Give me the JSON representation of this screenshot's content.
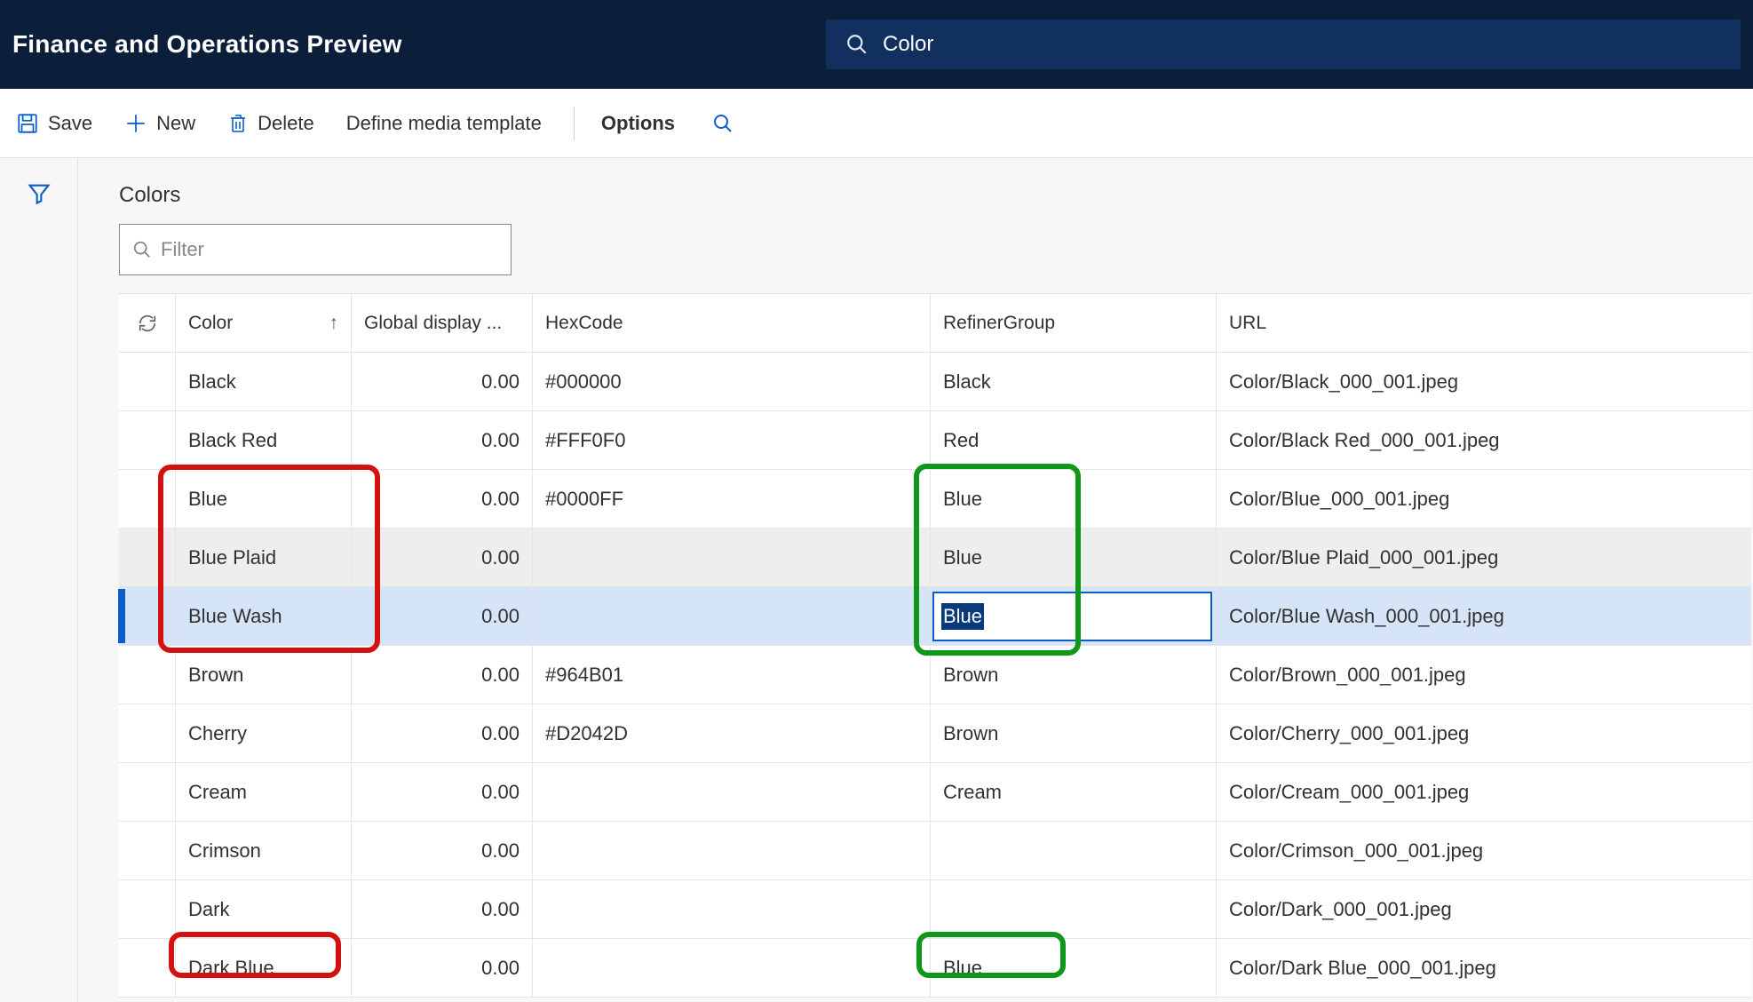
{
  "header": {
    "title": "Finance and Operations Preview",
    "search_value": "Color"
  },
  "actionbar": {
    "save": "Save",
    "new": "New",
    "delete": "Delete",
    "define_media_template": "Define media template",
    "options": "Options"
  },
  "page": {
    "title": "Colors",
    "filter_placeholder": "Filter"
  },
  "grid": {
    "columns": {
      "color": "Color",
      "global_display": "Global display ...",
      "hexcode": "HexCode",
      "refiner_group": "RefinerGroup",
      "url": "URL"
    },
    "rows": [
      {
        "color": "Black",
        "gdo": "0.00",
        "hex": "#000000",
        "ref": "Black",
        "url": "Color/Black_000_001.jpeg"
      },
      {
        "color": "Black Red",
        "gdo": "0.00",
        "hex": "#FFF0F0",
        "ref": "Red",
        "url": "Color/Black Red_000_001.jpeg"
      },
      {
        "color": "Blue",
        "gdo": "0.00",
        "hex": "#0000FF",
        "ref": "Blue",
        "url": "Color/Blue_000_001.jpeg"
      },
      {
        "color": "Blue Plaid",
        "gdo": "0.00",
        "hex": "",
        "ref": "Blue",
        "url": "Color/Blue Plaid_000_001.jpeg"
      },
      {
        "color": "Blue Wash",
        "gdo": "0.00",
        "hex": "",
        "ref": "Blue",
        "url": "Color/Blue Wash_000_001.jpeg"
      },
      {
        "color": "Brown",
        "gdo": "0.00",
        "hex": "#964B01",
        "ref": "Brown",
        "url": "Color/Brown_000_001.jpeg"
      },
      {
        "color": "Cherry",
        "gdo": "0.00",
        "hex": "#D2042D",
        "ref": "Brown",
        "url": "Color/Cherry_000_001.jpeg"
      },
      {
        "color": "Cream",
        "gdo": "0.00",
        "hex": "",
        "ref": "Cream",
        "url": "Color/Cream_000_001.jpeg"
      },
      {
        "color": "Crimson",
        "gdo": "0.00",
        "hex": "",
        "ref": "",
        "url": "Color/Crimson_000_001.jpeg"
      },
      {
        "color": "Dark",
        "gdo": "0.00",
        "hex": "",
        "ref": "",
        "url": "Color/Dark_000_001.jpeg"
      },
      {
        "color": "Dark Blue",
        "gdo": "0.00",
        "hex": "",
        "ref": "Blue",
        "url": "Color/Dark Blue_000_001.jpeg"
      }
    ],
    "selected_index": 4,
    "alt_index": 3
  }
}
